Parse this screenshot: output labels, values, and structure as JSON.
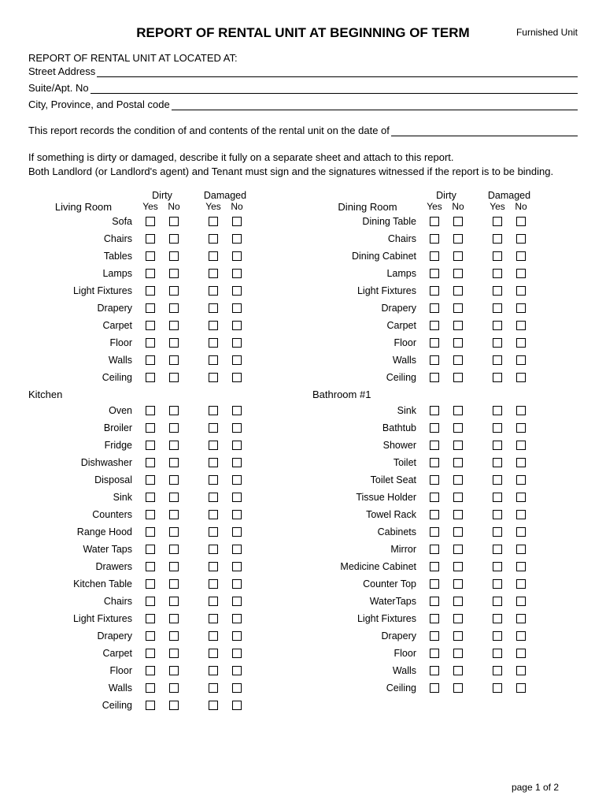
{
  "title": "REPORT OF RENTAL UNIT AT BEGINNING OF TERM",
  "furnished": "Furnished Unit",
  "located": "REPORT OF RENTAL UNIT AT LOCATED AT:",
  "fields": {
    "street": "Street Address",
    "suite": "Suite/Apt. No",
    "city": "City, Province, and Postal code"
  },
  "intro": "This report records the condition of and contents of the rental unit on the date of",
  "note1": "If something is dirty or damaged, describe it fully on a separate sheet and attach to this report.",
  "note2": "Both Landlord (or Landlord's agent) and Tenant must sign and the signatures witnessed if the report is to be binding.",
  "hdr": {
    "dirty": "Dirty",
    "damaged": "Damaged",
    "yes": "Yes",
    "no": "No"
  },
  "sections": {
    "living": {
      "name": "Living Room",
      "items": [
        "Sofa",
        "Chairs",
        "Tables",
        "Lamps",
        "Light Fixtures",
        "Drapery",
        "Carpet",
        "Floor",
        "Walls",
        "Ceiling"
      ]
    },
    "kitchen": {
      "name": "Kitchen",
      "items": [
        "Oven",
        "Broiler",
        "Fridge",
        "Dishwasher",
        "Disposal",
        "Sink",
        "Counters",
        "Range Hood",
        "Water Taps",
        "Drawers",
        "Kitchen Table",
        "Chairs",
        "Light Fixtures",
        "Drapery",
        "Carpet",
        "Floor",
        "Walls",
        "Ceiling"
      ]
    },
    "dining": {
      "name": "Dining Room",
      "items": [
        "Dining Table",
        "Chairs",
        "Dining Cabinet",
        "Lamps",
        "Light Fixtures",
        "Drapery",
        "Carpet",
        "Floor",
        "Walls",
        "Ceiling"
      ]
    },
    "bath": {
      "name": "Bathroom #1",
      "items": [
        "Sink",
        "Bathtub",
        "Shower",
        "Toilet",
        "Toilet Seat",
        "Tissue Holder",
        "Towel Rack",
        "Cabinets",
        "Mirror",
        "Medicine Cabinet",
        "Counter Top",
        "WaterTaps",
        "Light Fixtures",
        "Drapery",
        "Floor",
        "Walls",
        "Ceiling"
      ]
    }
  },
  "footer": "page 1 of 2"
}
